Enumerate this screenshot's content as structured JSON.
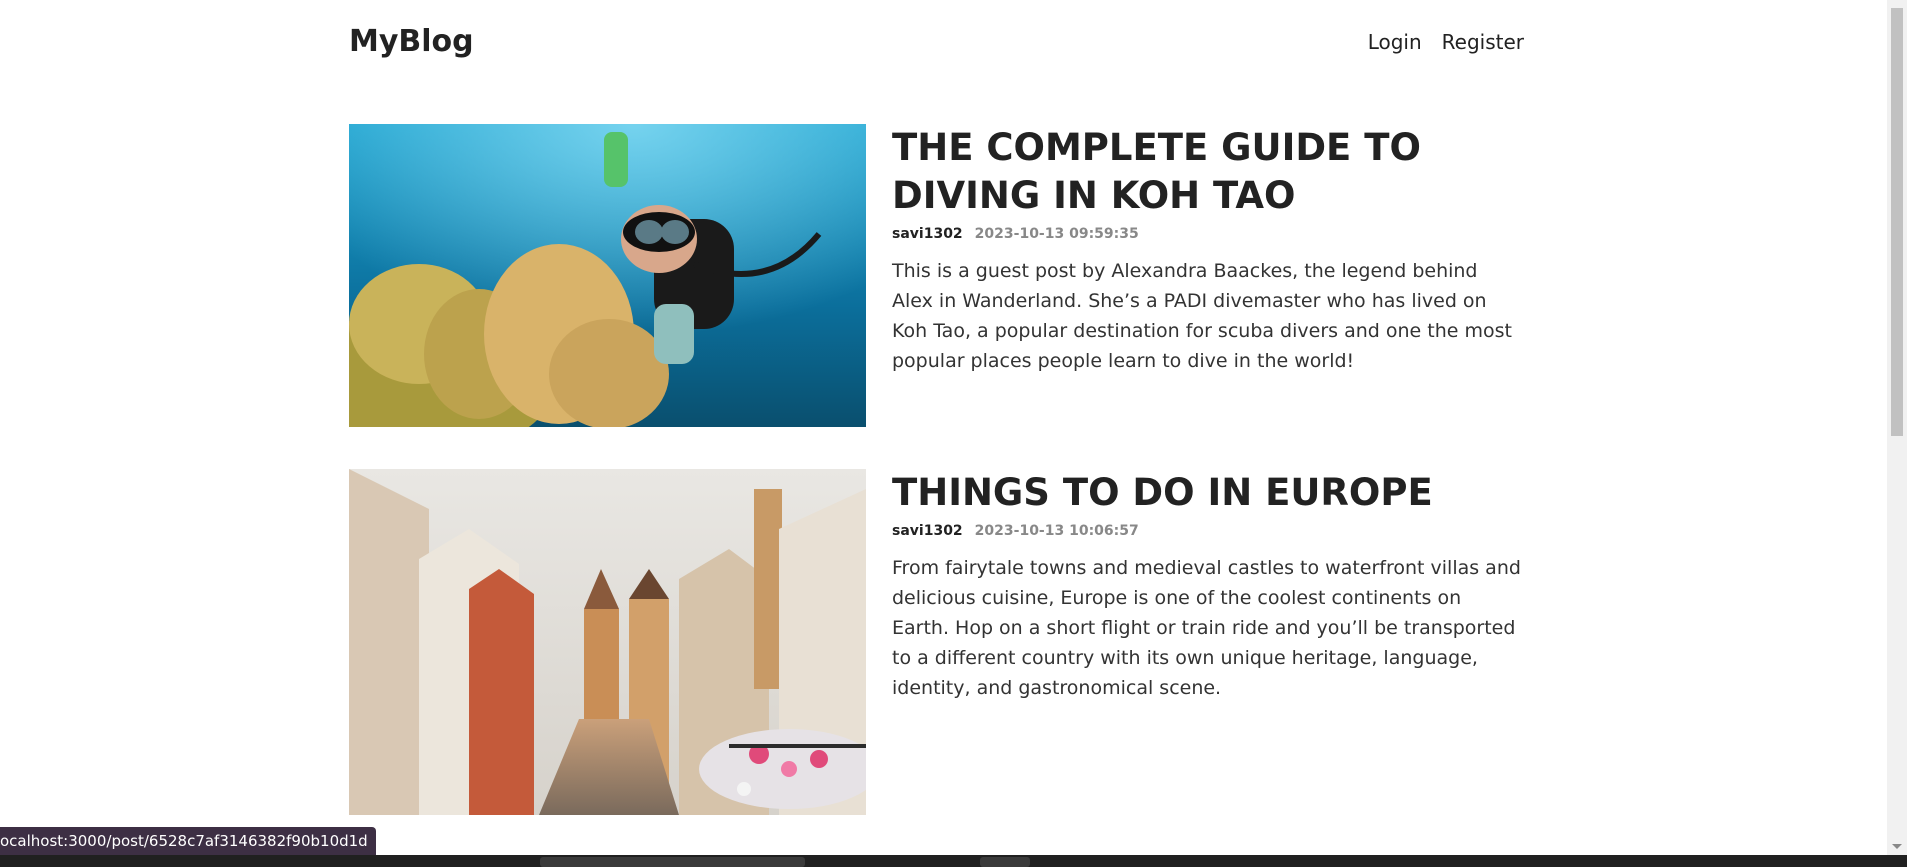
{
  "header": {
    "logo": "MyBlog",
    "nav": {
      "login": "Login",
      "register": "Register"
    }
  },
  "posts": [
    {
      "title": "THE COMPLETE GUIDE TO DIVING IN KOH TAO",
      "author": "savi1302",
      "date": "2023-10-13 09:59:35",
      "summary": "This is a guest post by Alexandra Baackes, the legend behind Alex in Wanderland. She’s a PADI divemaster who has lived on Koh Tao, a popular destination for scuba divers and one the most popular places people learn to dive in the world!"
    },
    {
      "title": "THINGS TO DO IN EUROPE",
      "author": "savi1302",
      "date": "2023-10-13 10:06:57",
      "summary": "From fairytale towns and medieval castles to waterfront villas and delicious cuisine, Europe is one of the coolest continents on Earth. Hop on a short flight or train ride and you’ll be transported to a different country with its own unique heritage, language, identity, and gastronomical scene."
    }
  ],
  "status_bar": {
    "url": "ocalhost:3000/post/6528c7af3146382f90b10d1d"
  }
}
